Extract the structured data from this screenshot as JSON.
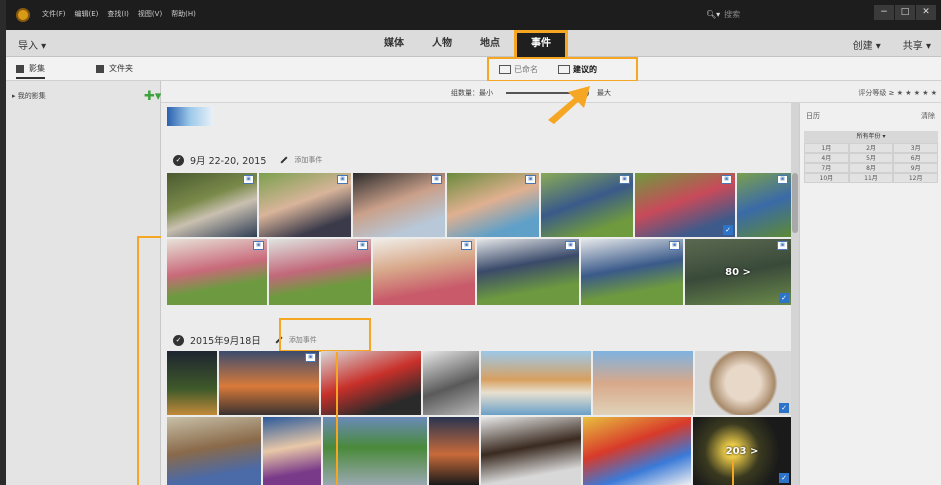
{
  "app": {
    "menu": [
      "文件(F)",
      "编辑(E)",
      "查找(I)",
      "视图(V)",
      "帮助(H)"
    ],
    "search_placeholder": "搜索",
    "window_buttons": [
      "−",
      "□",
      "✕"
    ]
  },
  "tabbar": {
    "import_label": "导入 ▾",
    "tabs": [
      "媒体",
      "人物",
      "地点",
      "事件"
    ],
    "active_tab": "事件",
    "create_label": "创建 ▾",
    "share_label": "共享 ▾"
  },
  "subbar": {
    "media_tab": "影集",
    "folder_tab": "文件夹",
    "named_label": "已命名",
    "suggested_label": "建议的"
  },
  "leftpanel": {
    "my_albums": "▸ 我的影集",
    "add_icon": "✚▾"
  },
  "countbar": {
    "count_label": "组数量：最小",
    "max_label": "最大",
    "rating_label": "评分等级 ≥ ★ ★ ★ ★ ★"
  },
  "groups": [
    {
      "date": "9月 22-20, 2015",
      "add_event": "添加事件"
    },
    {
      "date": "2015年9月18日",
      "add_event": "添加事件"
    }
  ],
  "more_count": "203 >",
  "more_count2": "80 >",
  "rightpanel": {
    "calendar_label": "日历",
    "clear_label": "清除",
    "year_label": "所有年份 ▾",
    "months": [
      "1月",
      "2月",
      "3月",
      "4月",
      "5月",
      "6月",
      "7月",
      "8月",
      "9月",
      "10月",
      "11月",
      "12月"
    ]
  },
  "colors": {
    "accent": "#f5a623",
    "titlebar": "#1d1d1d",
    "selected_tick": "#2d73c8"
  }
}
